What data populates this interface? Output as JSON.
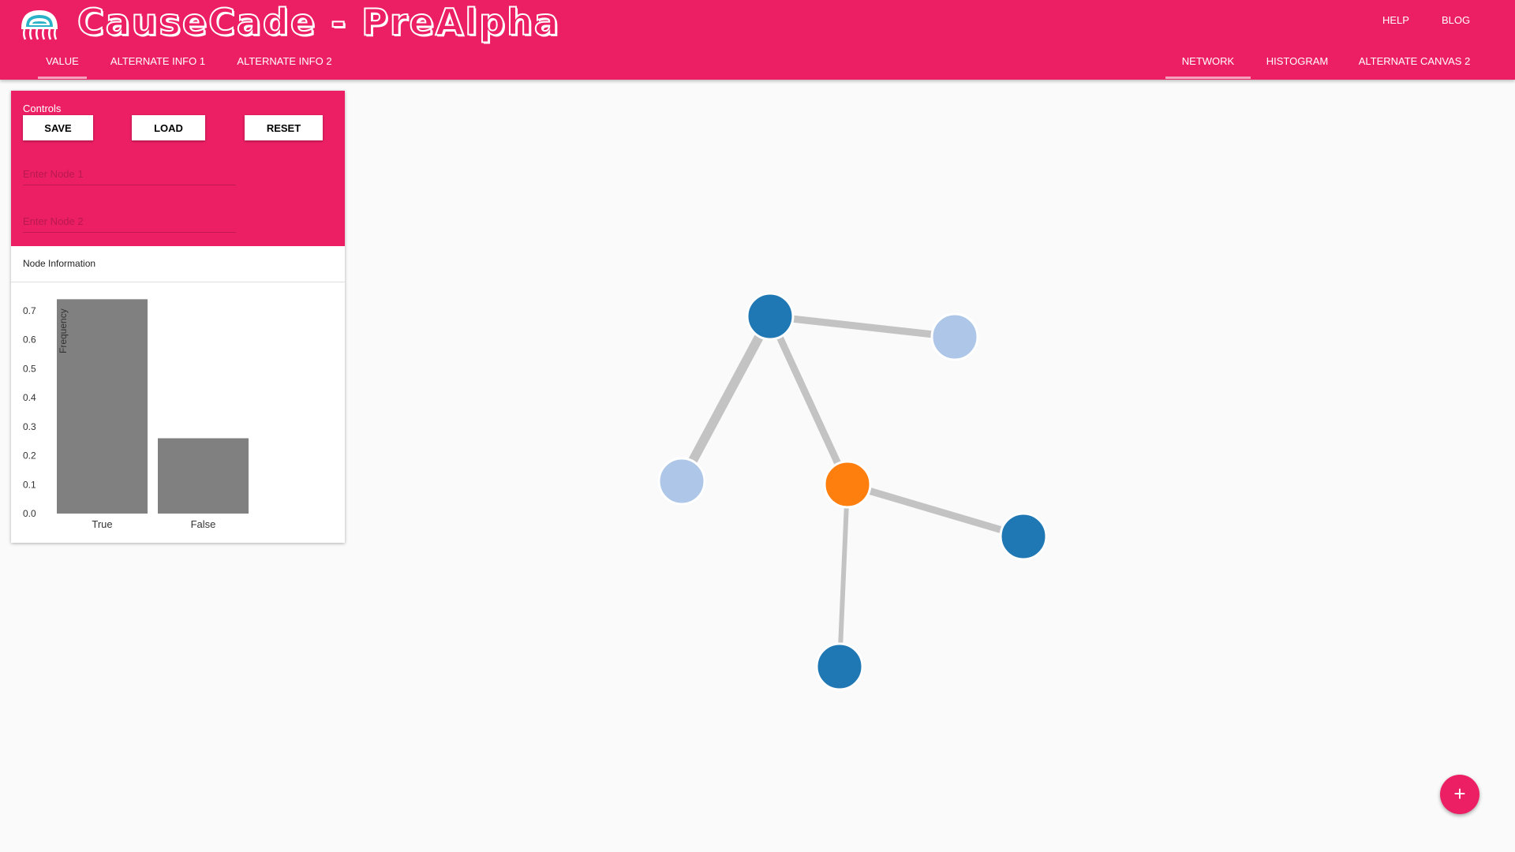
{
  "app": {
    "title": "CauseCade - PreAlpha",
    "logo_icon": "jellyfish-logo-icon",
    "brand_color": "#ec1f65"
  },
  "top_links": {
    "help": "HELP",
    "blog": "BLOG"
  },
  "info_tabs": [
    {
      "label": "VALUE",
      "active": true
    },
    {
      "label": "ALTERNATE INFO 1",
      "active": false
    },
    {
      "label": "ALTERNATE INFO 2",
      "active": false
    }
  ],
  "canvas_tabs": [
    {
      "label": "NETWORK",
      "active": true
    },
    {
      "label": "HISTOGRAM",
      "active": false
    },
    {
      "label": "ALTERNATE CANVAS 2",
      "active": false
    }
  ],
  "controls": {
    "title": "Controls",
    "save_label": "SAVE",
    "load_label": "LOAD",
    "reset_label": "RESET",
    "node1_placeholder": "Enter Node 1",
    "node2_placeholder": "Enter Node 2",
    "node1_value": "",
    "node2_value": ""
  },
  "node_info": {
    "title": "Node Information"
  },
  "chart_data": {
    "type": "bar",
    "categories": [
      "True",
      "False"
    ],
    "values": [
      0.74,
      0.26
    ],
    "ylabel": "Frequency",
    "yticks": [
      0.0,
      0.1,
      0.2,
      0.3,
      0.4,
      0.5,
      0.6,
      0.7
    ],
    "ylim": [
      0,
      0.74
    ],
    "bar_color": "#808080",
    "grid": false
  },
  "network": {
    "nodes": [
      {
        "id": "n1",
        "color": "#1f77b4"
      },
      {
        "id": "n2",
        "color": "#aec7e8"
      },
      {
        "id": "n3",
        "color": "#aec7e8"
      },
      {
        "id": "n4",
        "color": "#ff7f0e"
      },
      {
        "id": "n5",
        "color": "#1f77b4"
      },
      {
        "id": "n6",
        "color": "#1f77b4"
      }
    ],
    "edges": [
      {
        "source": "n1",
        "target": "n2",
        "weight": 3
      },
      {
        "source": "n1",
        "target": "n3",
        "weight": 4
      },
      {
        "source": "n1",
        "target": "n4",
        "weight": 3
      },
      {
        "source": "n4",
        "target": "n5",
        "weight": 3
      },
      {
        "source": "n4",
        "target": "n6",
        "weight": 2
      }
    ],
    "edge_color": "#c3c3c3",
    "selected_node": "n4"
  },
  "fab": {
    "label": "+",
    "icon": "plus-icon"
  }
}
